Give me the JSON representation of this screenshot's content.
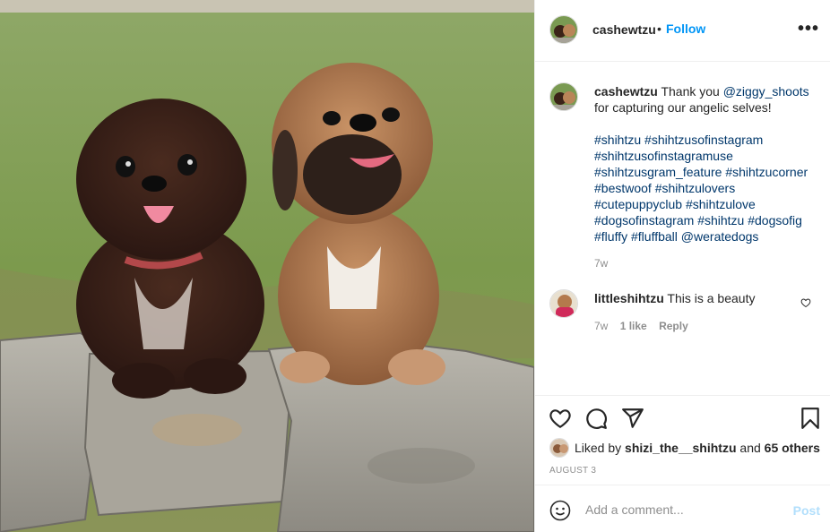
{
  "post": {
    "username": "cashewtzu",
    "dot": "•",
    "follow_label": "Follow",
    "more_icon": "more-horizontal-icon",
    "photo_subject": "two shih tzu dogs sitting on stone ledge"
  },
  "caption": {
    "username": "cashewtzu",
    "text_before": "Thank you ",
    "mention": "@ziggy_shoots",
    "text_after": " for capturing our angelic selves!",
    "hashtags": [
      "#shihtzu",
      "#shihtzusofinstagram",
      "#shihtzusofinstagramuse",
      "#shihtzusgram_feature",
      "#shihtzucorner",
      "#bestwoof",
      "#shihtzulovers",
      "#cutepuppyclub",
      "#shihtzulove",
      "#dogsofinstagram",
      "#shihtzu",
      "#dogsofig",
      "#fluffy",
      "#fluffball"
    ],
    "end_mention": "@weratedogs",
    "age": "7w"
  },
  "comment": {
    "username": "littleshihtzu",
    "text": "This is a beauty",
    "age": "7w",
    "likes": "1 like",
    "reply_label": "Reply"
  },
  "actions": {
    "like_icon": "heart-icon",
    "comment_icon": "comment-icon",
    "share_icon": "send-icon",
    "save_icon": "bookmark-icon"
  },
  "likes": {
    "prefix": "Liked by ",
    "user": "shizi_the__shihtzu",
    "middle": " and ",
    "others": "65 others"
  },
  "date": "AUGUST 3",
  "add_comment": {
    "placeholder": "Add a comment...",
    "post_label": "Post"
  },
  "colors": {
    "link": "#00376b",
    "follow": "#0095f6",
    "muted": "#8e8e8e",
    "post_disabled": "#b2dffc"
  }
}
